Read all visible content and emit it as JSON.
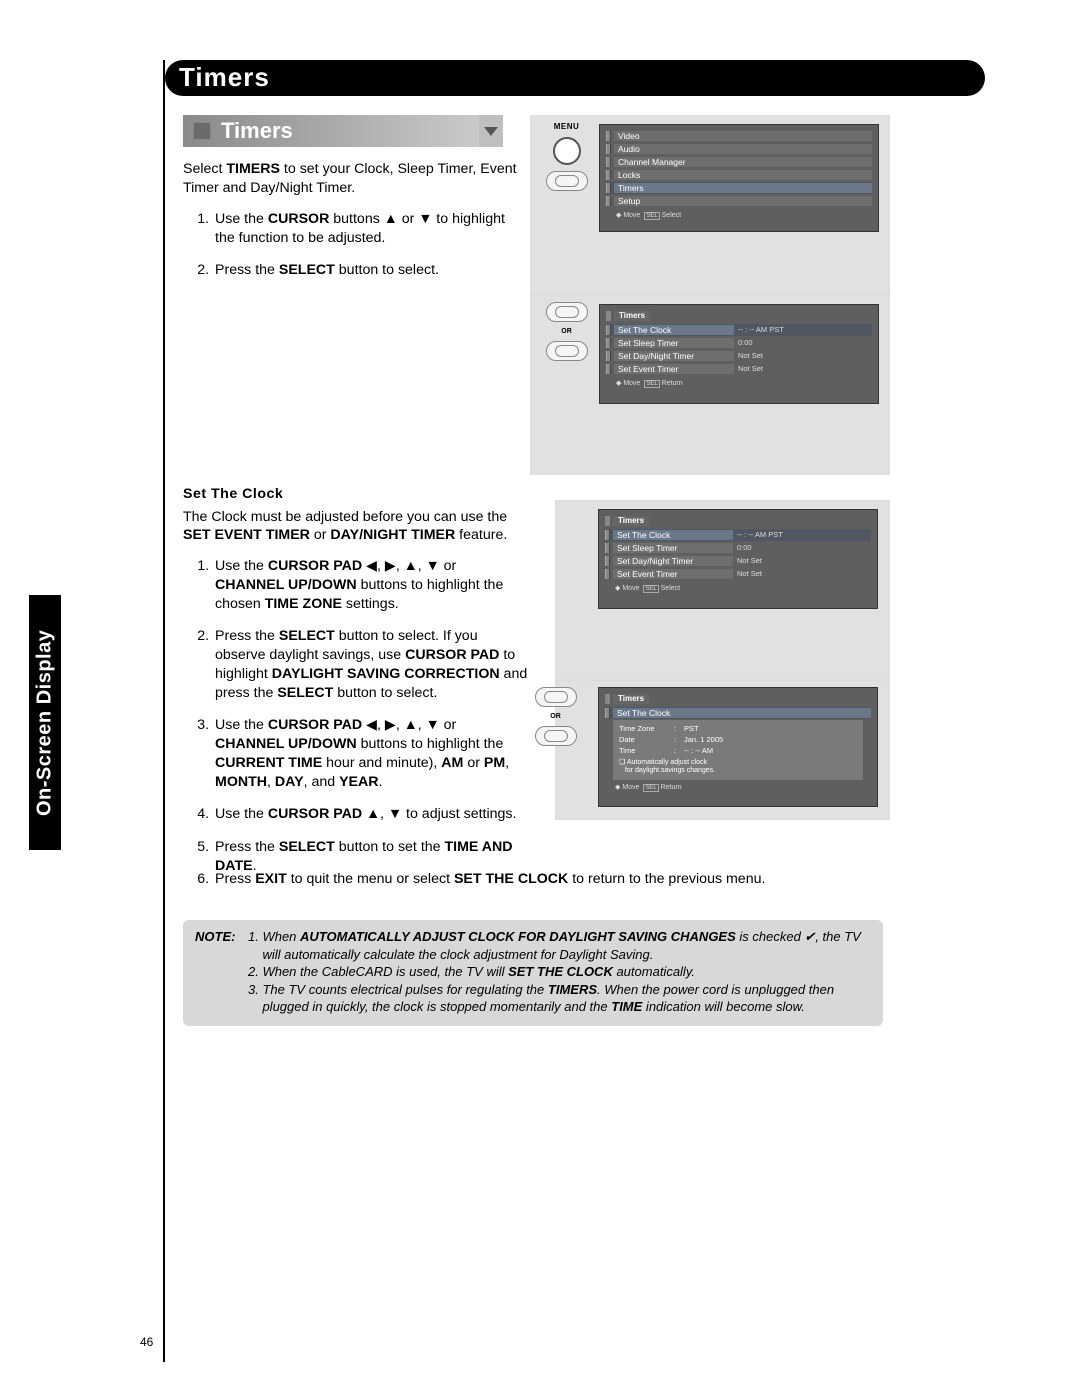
{
  "header": {
    "title": "Timers"
  },
  "sectionBar": {
    "title": "Timers"
  },
  "sideTab": {
    "label": "On-Screen Display"
  },
  "intro": {
    "line1_a": "Select ",
    "line1_b": "TIMERS",
    "line1_c": " to set your Clock, Sleep Timer, Event Timer and Day/Night Timer."
  },
  "steps1": {
    "s1a": "Use the ",
    "s1b": "CURSOR",
    "s1c": " buttons ",
    "s1d": " or ",
    "s1e": " to highlight the function to be adjusted.",
    "s2a": "Press the ",
    "s2b": "SELECT",
    "s2c": " button to select."
  },
  "setClock": {
    "heading": "Set The Clock",
    "p1a": "The Clock must be adjusted before you can use the ",
    "p1b": "SET EVENT TIMER",
    "p1c": " or ",
    "p1d": "DAY/NIGHT TIMER",
    "p1e": " feature.",
    "s1a": "Use the ",
    "s1b": "CURSOR PAD ",
    "s1c": " or ",
    "s1d": "CHANNEL UP/DOWN",
    "s1e": " buttons to highlight the chosen ",
    "s1f": "TIME ZONE",
    "s1g": " settings.",
    "s2a": "Press the ",
    "s2b": "SELECT",
    "s2c": " button to select. If you observe daylight savings, use ",
    "s2d": "CURSOR PAD",
    "s2e": " to highlight ",
    "s2f": "DAYLIGHT SAVING CORRECTION",
    "s2g": " and press the ",
    "s2h": "SELECT",
    "s2i": " button to select.",
    "s3a": "Use the ",
    "s3b": "CURSOR PAD ",
    "s3c": " or ",
    "s3d": "CHANNEL UP/DOWN",
    "s3e": " buttons to highlight the ",
    "s3f": "CURRENT TIME",
    "s3g": " hour and minute), ",
    "s3h": "AM",
    "s3i": " or ",
    "s3j": "PM",
    "s3k": ", ",
    "s3l": "MONTH",
    "s3m": ", ",
    "s3n": "DAY",
    "s3o": ", and ",
    "s3p": "YEAR",
    "s3q": ".",
    "s4a": "Use the ",
    "s4b": "CURSOR PAD ",
    "s4c": " to adjust settings.",
    "s5a": "Press the ",
    "s5b": "SELECT",
    "s5c": " button to set the ",
    "s5d": "TIME AND DATE",
    "s5e": ".",
    "s6a": "Press ",
    "s6b": "EXIT",
    "s6c": " to quit the menu or select ",
    "s6d": "SET THE CLOCK",
    "s6e": " to return to the previous menu."
  },
  "remote": {
    "menu": "MENU",
    "or": "OR"
  },
  "osd1": {
    "items": [
      "Video",
      "Audio",
      "Channel Manager",
      "Locks",
      "Timers",
      "Setup"
    ],
    "highlight": 4,
    "foot_move": "Move",
    "foot_sel": "SEL",
    "foot_select": "Select"
  },
  "osd2": {
    "title": "Timers",
    "rows": [
      {
        "label": "Set The Clock",
        "val": "-- : -- AM PST"
      },
      {
        "label": "Set Sleep Timer",
        "val": "0:00"
      },
      {
        "label": "Set Day/Night Timer",
        "val": "Not Set"
      },
      {
        "label": "Set Event Timer",
        "val": "Not Set"
      }
    ],
    "highlight": 0,
    "foot_move": "Move",
    "foot_sel": "SEL",
    "foot_return": "Return"
  },
  "osd3": {
    "title": "Timers",
    "rows": [
      {
        "label": "Set The Clock",
        "val": "-- : -- AM PST"
      },
      {
        "label": "Set Sleep Timer",
        "val": "0:00"
      },
      {
        "label": "Set Day/Night Timer",
        "val": "Not Set"
      },
      {
        "label": "Set Event Timer",
        "val": "Not Set"
      }
    ],
    "highlight": 0,
    "foot_move": "Move",
    "foot_sel": "SEL",
    "foot_select": "Select"
  },
  "osd4": {
    "title": "Timers",
    "sub": "Set The Clock",
    "tz_k": "Time Zone",
    "tz_v": "PST",
    "dt_k": "Date",
    "dt_v": "Jan. 1 2005",
    "tm_k": "Time",
    "tm_v": "-- : -- AM",
    "note1": "Automatically adjust clock",
    "note2": "for daylight savings changes.",
    "foot_move": "Move",
    "foot_sel": "SEL",
    "foot_return": "Return"
  },
  "note": {
    "head": "NOTE:",
    "n1a": "When ",
    "n1b": "AUTOMATICALLY ADJUST CLOCK FOR DAYLIGHT SAVING CHANGES",
    "n1c": " is checked ✔, the TV will automatically calculate the clock adjustment for Daylight Saving.",
    "n2a": "When the CableCARD is used, the TV will ",
    "n2b": "SET THE CLOCK",
    "n2c": " automatically.",
    "n3a": "The TV counts electrical pulses for regulating the ",
    "n3b": "TIMERS",
    "n3c": ". When the power cord is unplugged then plugged in quickly, the clock is stopped momentarily and the ",
    "n3d": "TIME",
    "n3e": " indication will become slow."
  },
  "pageNum": "46"
}
